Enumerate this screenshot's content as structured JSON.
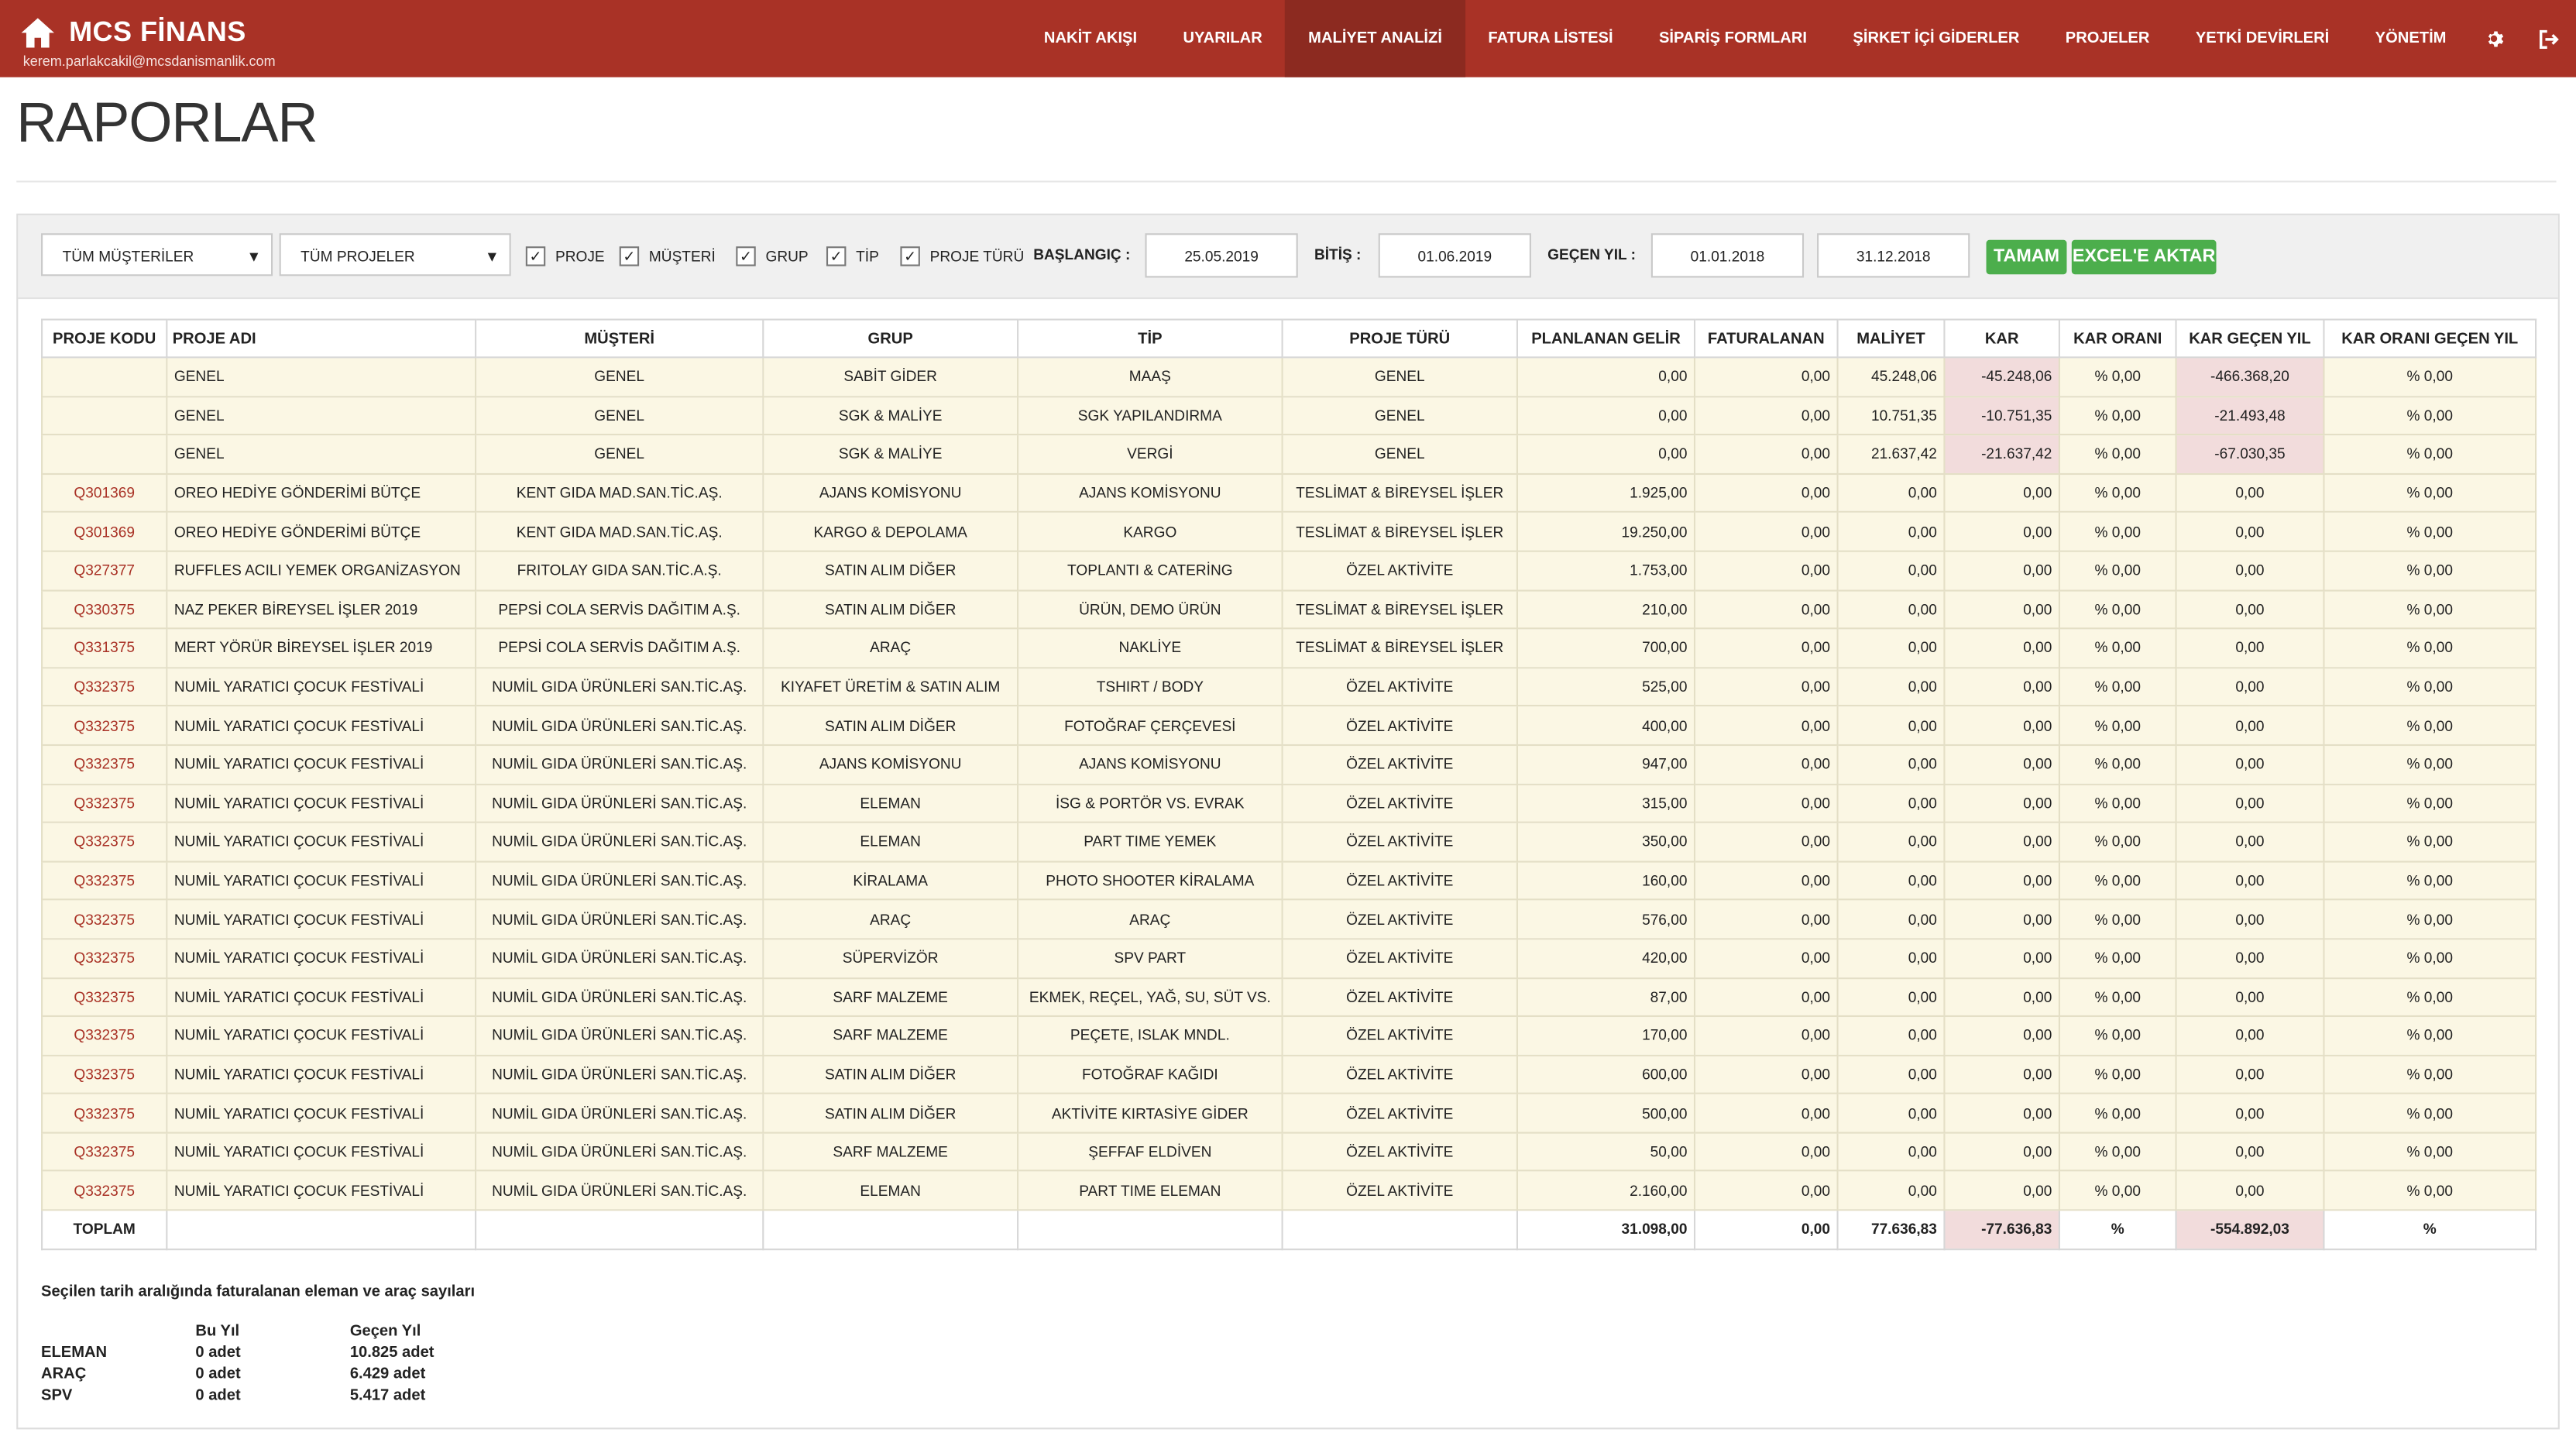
{
  "nav": {
    "brand_title": "MCS FİNANS",
    "user_email": "kerem.parlakcakil@mcsdanismanlik.com",
    "items": [
      {
        "label": "NAKİT AKIŞI",
        "active": false
      },
      {
        "label": "UYARILAR",
        "active": false
      },
      {
        "label": "MALİYET ANALİZİ",
        "active": true
      },
      {
        "label": "FATURA LİSTESİ",
        "active": false
      },
      {
        "label": "SİPARİŞ FORMLARI",
        "active": false
      },
      {
        "label": "ŞİRKET İÇİ GİDERLER",
        "active": false
      },
      {
        "label": "PROJELER",
        "active": false
      },
      {
        "label": "YETKİ DEVİRLERİ",
        "active": false
      },
      {
        "label": "YÖNETİM",
        "active": false
      }
    ],
    "settings_icon": "gear-icon",
    "logout_icon": "logout-icon",
    "home_icon": "home-icon"
  },
  "colors": {
    "brand": "#a93226",
    "active_nav": "#8c2a20",
    "button": "#4cae4c",
    "row_bg": "#fbf7e4",
    "negative_bg": "#f2dcdc"
  },
  "page": {
    "title": "RAPORLAR"
  },
  "filters": {
    "customer_select": "TÜM MÜŞTERİLER",
    "project_select": "TÜM PROJELER",
    "checkboxes": [
      "PROJE",
      "MÜŞTERİ",
      "GRUP",
      "TİP",
      "PROJE TÜRÜ"
    ],
    "start_label": "BAŞLANGIÇ :",
    "start_value": "25.05.2019",
    "end_label": "BİTİŞ :",
    "end_value": "01.06.2019",
    "prev_year_label": "GEÇEN YIL :",
    "prev_year_start": "01.01.2018",
    "prev_year_end": "31.12.2018",
    "ok_button": "TAMAM",
    "excel_button": "EXCEL'E AKTAR"
  },
  "table": {
    "headers": [
      "PROJE KODU",
      "PROJE ADI",
      "MÜŞTERİ",
      "GRUP",
      "TİP",
      "PROJE TÜRÜ",
      "PLANLANAN GELİR",
      "FATURALANAN",
      "MALİYET",
      "KAR",
      "KAR ORANI",
      "KAR GEÇEN YIL",
      "KAR ORANI GEÇEN YIL"
    ],
    "rows": [
      [
        "",
        "GENEL",
        "GENEL",
        "SABİT GİDER",
        "MAAŞ",
        "GENEL",
        "0,00",
        "0,00",
        "45.248,06",
        "-45.248,06",
        "% 0,00",
        "-466.368,20",
        "% 0,00"
      ],
      [
        "",
        "GENEL",
        "GENEL",
        "SGK & MALİYE",
        "SGK YAPILANDIRMA",
        "GENEL",
        "0,00",
        "0,00",
        "10.751,35",
        "-10.751,35",
        "% 0,00",
        "-21.493,48",
        "% 0,00"
      ],
      [
        "",
        "GENEL",
        "GENEL",
        "SGK & MALİYE",
        "VERGİ",
        "GENEL",
        "0,00",
        "0,00",
        "21.637,42",
        "-21.637,42",
        "% 0,00",
        "-67.030,35",
        "% 0,00"
      ],
      [
        "Q301369",
        "OREO HEDİYE GÖNDERİMİ BÜTÇE",
        "KENT GIDA MAD.SAN.TİC.AŞ.",
        "AJANS KOMİSYONU",
        "AJANS KOMİSYONU",
        "TESLİMAT & BİREYSEL İŞLER",
        "1.925,00",
        "0,00",
        "0,00",
        "0,00",
        "% 0,00",
        "0,00",
        "% 0,00"
      ],
      [
        "Q301369",
        "OREO HEDİYE GÖNDERİMİ BÜTÇE",
        "KENT GIDA MAD.SAN.TİC.AŞ.",
        "KARGO & DEPOLAMA",
        "KARGO",
        "TESLİMAT & BİREYSEL İŞLER",
        "19.250,00",
        "0,00",
        "0,00",
        "0,00",
        "% 0,00",
        "0,00",
        "% 0,00"
      ],
      [
        "Q327377",
        "RUFFLES ACILI YEMEK ORGANİZASYON",
        "FRITOLAY GIDA SAN.TİC.A.Ş.",
        "SATIN ALIM DİĞER",
        "TOPLANTI & CATERİNG",
        "ÖZEL AKTİVİTE",
        "1.753,00",
        "0,00",
        "0,00",
        "0,00",
        "% 0,00",
        "0,00",
        "% 0,00"
      ],
      [
        "Q330375",
        "NAZ PEKER BİREYSEL İŞLER 2019",
        "PEPSİ COLA SERVİS DAĞITIM A.Ş.",
        "SATIN ALIM DİĞER",
        "ÜRÜN, DEMO ÜRÜN",
        "TESLİMAT & BİREYSEL İŞLER",
        "210,00",
        "0,00",
        "0,00",
        "0,00",
        "% 0,00",
        "0,00",
        "% 0,00"
      ],
      [
        "Q331375",
        "MERT YÖRÜR BİREYSEL İŞLER 2019",
        "PEPSİ COLA SERVİS DAĞITIM A.Ş.",
        "ARAÇ",
        "NAKLİYE",
        "TESLİMAT & BİREYSEL İŞLER",
        "700,00",
        "0,00",
        "0,00",
        "0,00",
        "% 0,00",
        "0,00",
        "% 0,00"
      ],
      [
        "Q332375",
        "NUMİL YARATICI ÇOCUK FESTİVALİ",
        "NUMİL GIDA ÜRÜNLERİ SAN.TİC.AŞ.",
        "KIYAFET ÜRETİM & SATIN ALIM",
        "TSHIRT / BODY",
        "ÖZEL AKTİVİTE",
        "525,00",
        "0,00",
        "0,00",
        "0,00",
        "% 0,00",
        "0,00",
        "% 0,00"
      ],
      [
        "Q332375",
        "NUMİL YARATICI ÇOCUK FESTİVALİ",
        "NUMİL GIDA ÜRÜNLERİ SAN.TİC.AŞ.",
        "SATIN ALIM DİĞER",
        "FOTOĞRAF ÇERÇEVESİ",
        "ÖZEL AKTİVİTE",
        "400,00",
        "0,00",
        "0,00",
        "0,00",
        "% 0,00",
        "0,00",
        "% 0,00"
      ],
      [
        "Q332375",
        "NUMİL YARATICI ÇOCUK FESTİVALİ",
        "NUMİL GIDA ÜRÜNLERİ SAN.TİC.AŞ.",
        "AJANS KOMİSYONU",
        "AJANS KOMİSYONU",
        "ÖZEL AKTİVİTE",
        "947,00",
        "0,00",
        "0,00",
        "0,00",
        "% 0,00",
        "0,00",
        "% 0,00"
      ],
      [
        "Q332375",
        "NUMİL YARATICI ÇOCUK FESTİVALİ",
        "NUMİL GIDA ÜRÜNLERİ SAN.TİC.AŞ.",
        "ELEMAN",
        "İSG & PORTÖR VS. EVRAK",
        "ÖZEL AKTİVİTE",
        "315,00",
        "0,00",
        "0,00",
        "0,00",
        "% 0,00",
        "0,00",
        "% 0,00"
      ],
      [
        "Q332375",
        "NUMİL YARATICI ÇOCUK FESTİVALİ",
        "NUMİL GIDA ÜRÜNLERİ SAN.TİC.AŞ.",
        "ELEMAN",
        "PART TIME YEMEK",
        "ÖZEL AKTİVİTE",
        "350,00",
        "0,00",
        "0,00",
        "0,00",
        "% 0,00",
        "0,00",
        "% 0,00"
      ],
      [
        "Q332375",
        "NUMİL YARATICI ÇOCUK FESTİVALİ",
        "NUMİL GIDA ÜRÜNLERİ SAN.TİC.AŞ.",
        "KİRALAMA",
        "PHOTO SHOOTER KİRALAMA",
        "ÖZEL AKTİVİTE",
        "160,00",
        "0,00",
        "0,00",
        "0,00",
        "% 0,00",
        "0,00",
        "% 0,00"
      ],
      [
        "Q332375",
        "NUMİL YARATICI ÇOCUK FESTİVALİ",
        "NUMİL GIDA ÜRÜNLERİ SAN.TİC.AŞ.",
        "ARAÇ",
        "ARAÇ",
        "ÖZEL AKTİVİTE",
        "576,00",
        "0,00",
        "0,00",
        "0,00",
        "% 0,00",
        "0,00",
        "% 0,00"
      ],
      [
        "Q332375",
        "NUMİL YARATICI ÇOCUK FESTİVALİ",
        "NUMİL GIDA ÜRÜNLERİ SAN.TİC.AŞ.",
        "SÜPERVİZÖR",
        "SPV PART",
        "ÖZEL AKTİVİTE",
        "420,00",
        "0,00",
        "0,00",
        "0,00",
        "% 0,00",
        "0,00",
        "% 0,00"
      ],
      [
        "Q332375",
        "NUMİL YARATICI ÇOCUK FESTİVALİ",
        "NUMİL GIDA ÜRÜNLERİ SAN.TİC.AŞ.",
        "SARF MALZEME",
        "EKMEK, REÇEL, YAĞ, SU, SÜT VS.",
        "ÖZEL AKTİVİTE",
        "87,00",
        "0,00",
        "0,00",
        "0,00",
        "% 0,00",
        "0,00",
        "% 0,00"
      ],
      [
        "Q332375",
        "NUMİL YARATICI ÇOCUK FESTİVALİ",
        "NUMİL GIDA ÜRÜNLERİ SAN.TİC.AŞ.",
        "SARF MALZEME",
        "PEÇETE, ISLAK MNDL.",
        "ÖZEL AKTİVİTE",
        "170,00",
        "0,00",
        "0,00",
        "0,00",
        "% 0,00",
        "0,00",
        "% 0,00"
      ],
      [
        "Q332375",
        "NUMİL YARATICI ÇOCUK FESTİVALİ",
        "NUMİL GIDA ÜRÜNLERİ SAN.TİC.AŞ.",
        "SATIN ALIM DİĞER",
        "FOTOĞRAF KAĞIDI",
        "ÖZEL AKTİVİTE",
        "600,00",
        "0,00",
        "0,00",
        "0,00",
        "% 0,00",
        "0,00",
        "% 0,00"
      ],
      [
        "Q332375",
        "NUMİL YARATICI ÇOCUK FESTİVALİ",
        "NUMİL GIDA ÜRÜNLERİ SAN.TİC.AŞ.",
        "SATIN ALIM DİĞER",
        "AKTİVİTE KIRTASİYE GİDER",
        "ÖZEL AKTİVİTE",
        "500,00",
        "0,00",
        "0,00",
        "0,00",
        "% 0,00",
        "0,00",
        "% 0,00"
      ],
      [
        "Q332375",
        "NUMİL YARATICI ÇOCUK FESTİVALİ",
        "NUMİL GIDA ÜRÜNLERİ SAN.TİC.AŞ.",
        "SARF MALZEME",
        "ŞEFFAF ELDİVEN",
        "ÖZEL AKTİVİTE",
        "50,00",
        "0,00",
        "0,00",
        "0,00",
        "% 0,00",
        "0,00",
        "% 0,00"
      ],
      [
        "Q332375",
        "NUMİL YARATICI ÇOCUK FESTİVALİ",
        "NUMİL GIDA ÜRÜNLERİ SAN.TİC.AŞ.",
        "ELEMAN",
        "PART TIME ELEMAN",
        "ÖZEL AKTİVİTE",
        "2.160,00",
        "0,00",
        "0,00",
        "0,00",
        "% 0,00",
        "0,00",
        "% 0,00"
      ]
    ],
    "total_row": [
      "TOPLAM",
      "",
      "",
      "",
      "",
      "",
      "31.098,00",
      "0,00",
      "77.636,83",
      "-77.636,83",
      "%",
      "-554.892,03",
      "%"
    ]
  },
  "summary": {
    "title": "Seçilen tarih aralığında faturalanan eleman ve araç sayıları",
    "col_this_year": "Bu Yıl",
    "col_last_year": "Geçen Yıl",
    "rows": [
      {
        "label": "ELEMAN",
        "this_year": "0 adet",
        "last_year": "10.825 adet"
      },
      {
        "label": "ARAÇ",
        "this_year": "0 adet",
        "last_year": "6.429 adet"
      },
      {
        "label": "SPV",
        "this_year": "0 adet",
        "last_year": "5.417 adet"
      }
    ]
  }
}
